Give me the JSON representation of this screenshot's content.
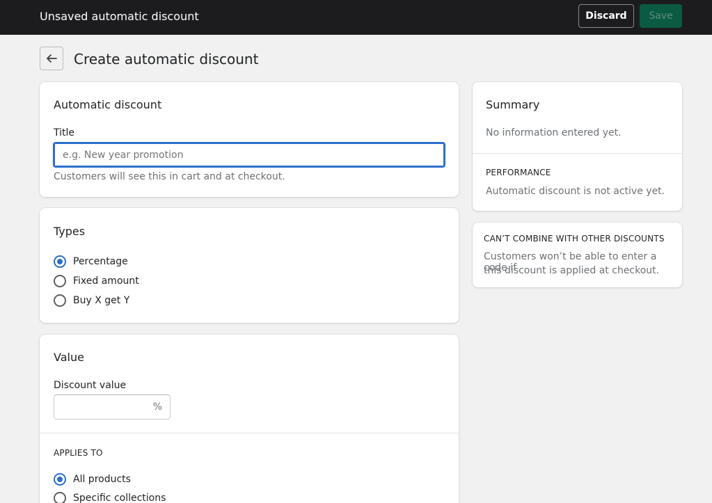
{
  "topbar": {
    "title": "Unsaved automatic discount",
    "discard_label": "Discard",
    "save_label": "Save"
  },
  "page": {
    "title": "Create automatic discount",
    "back_icon": "arrow-left-icon"
  },
  "discount_card": {
    "heading": "Automatic discount",
    "title_label": "Title",
    "title_placeholder": "e.g. New year promotion",
    "title_value": "",
    "help_text": "Customers will see this in cart and at checkout."
  },
  "types_card": {
    "heading": "Types",
    "options": [
      {
        "label": "Percentage",
        "checked": true
      },
      {
        "label": "Fixed amount",
        "checked": false
      },
      {
        "label": "Buy X get Y",
        "checked": false
      }
    ]
  },
  "value_card": {
    "heading": "Value",
    "discount_value_label": "Discount value",
    "discount_value": "",
    "suffix": "%",
    "applies_to_heading": "APPLIES TO",
    "applies_options": [
      {
        "label": "All products",
        "checked": true
      },
      {
        "label": "Specific collections",
        "checked": false
      }
    ]
  },
  "summary_card": {
    "heading": "Summary",
    "empty_text": "No information entered yet.",
    "performance_heading": "PERFORMANCE",
    "performance_text": "Automatic discount is not active yet."
  },
  "combine_card": {
    "heading": "CAN’T COMBINE WITH OTHER DISCOUNTS",
    "line1": "Customers won’t be able to enter a code if",
    "line2": "this discount is applied at checkout."
  },
  "colors": {
    "topbar_bg": "#1c1c1e",
    "save_bg": "#0b5a43",
    "accent": "#2c6ecb",
    "page_bg": "#f1f1f2"
  }
}
